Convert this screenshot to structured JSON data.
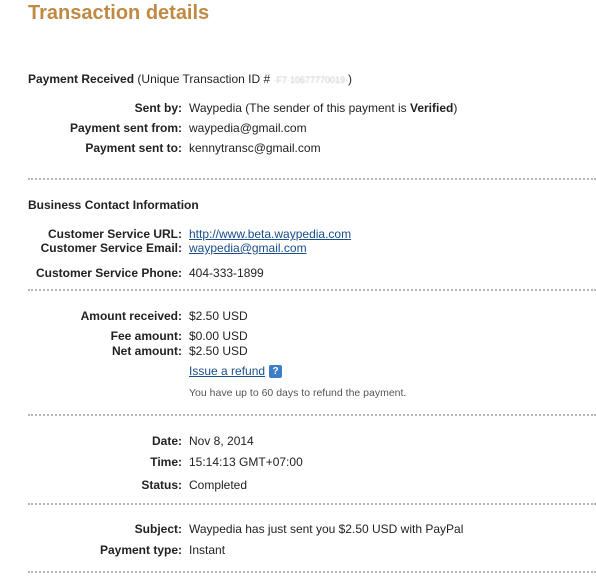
{
  "page": {
    "title": "Transaction details"
  },
  "payment": {
    "heading": "Payment Received",
    "txn_prefix": "(Unique Transaction ID #",
    "txn_id_masked": "·F7·10677770019·",
    "txn_suffix": ")",
    "sent_by_label": "Sent by:",
    "sent_by_value": "Waypedia (The sender of this payment is ",
    "sent_by_status": "Verified",
    "sent_by_close": ")",
    "sent_from_label": "Payment sent from:",
    "sent_from_value": "waypedia@gmail.com",
    "sent_to_label": "Payment sent to:",
    "sent_to_value": "kennytransc@gmail.com"
  },
  "business": {
    "heading": "Business Contact Information",
    "url_label": "Customer Service URL:",
    "url_value": "http://www.beta.waypedia.com",
    "email_label": "Customer Service Email:",
    "email_value": "waypedia@gmail.com",
    "phone_label": "Customer Service Phone:",
    "phone_value": "404-333-1899"
  },
  "amounts": {
    "received_label": "Amount received:",
    "received_value": "$2.50 USD",
    "fee_label": "Fee amount:",
    "fee_value": "$0.00 USD",
    "net_label": "Net amount:",
    "net_value": "$2.50 USD",
    "refund_link": "Issue a refund",
    "help_glyph": "?",
    "refund_note": "You have up to 60 days to refund the payment."
  },
  "timing": {
    "date_label": "Date:",
    "date_value": "Nov 8, 2014",
    "time_label": "Time:",
    "time_value": "15:14:13 GMT+07:00",
    "status_label": "Status:",
    "status_value": "Completed"
  },
  "details": {
    "subject_label": "Subject:",
    "subject_value": "Waypedia has just sent you $2.50 USD with PayPal",
    "type_label": "Payment type:",
    "type_value": "Instant"
  },
  "icons": {
    "help": "help-question-icon"
  },
  "colors": {
    "title": "#c08a44",
    "link": "#1a4e8a",
    "help_icon": "#3d7ec8",
    "separator": "#b5b5b5"
  }
}
